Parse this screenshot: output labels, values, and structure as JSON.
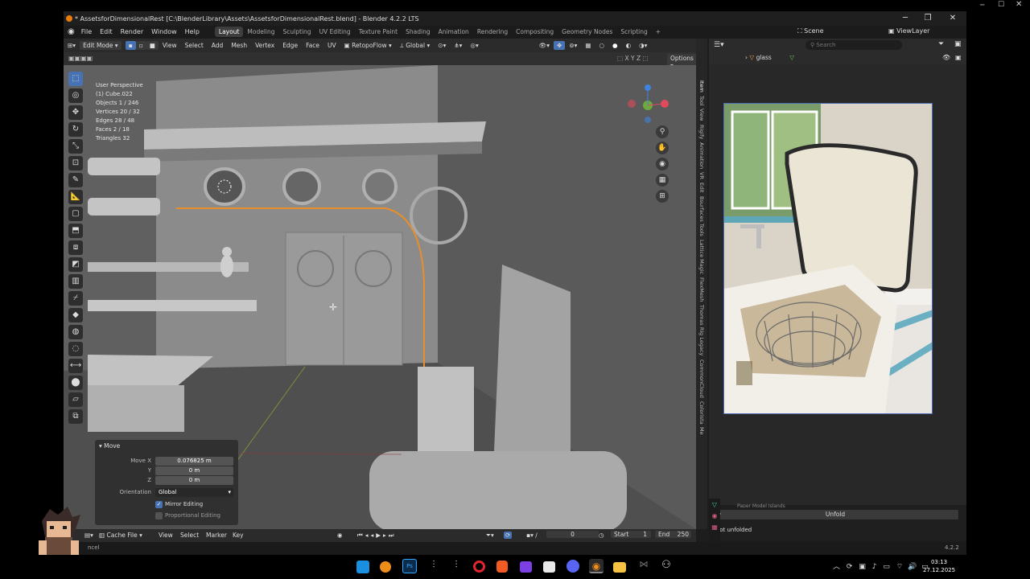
{
  "window": {
    "title": "* AssetsforDimensionalRest [C:\\BlenderLibrary\\Assets\\AssetsforDimensionalRest.blend] - Blender 4.2.2 LTS"
  },
  "menu": [
    "File",
    "Edit",
    "Render",
    "Window",
    "Help"
  ],
  "workspaces": [
    "Layout",
    "Modeling",
    "Sculpting",
    "UV Editing",
    "Texture Paint",
    "Shading",
    "Animation",
    "Rendering",
    "Compositing",
    "Geometry Nodes",
    "Scripting"
  ],
  "active_workspace": "Layout",
  "scene_label": "Scene",
  "viewlayer_label": "ViewLayer",
  "viewport_header": {
    "mode": "Edit Mode",
    "items": [
      "View",
      "Select",
      "Add",
      "Mesh",
      "Vertex",
      "Edge",
      "Face",
      "UV"
    ],
    "addon": "RetopoFlow",
    "orientation": "Global",
    "options": "Options"
  },
  "overlay_stats": {
    "view": "User Perspective",
    "object": "(1) Cube.022",
    "rows": [
      {
        "label": "Objects",
        "value": "1 / 246"
      },
      {
        "label": "Vertices",
        "value": "20 / 32"
      },
      {
        "label": "Edges",
        "value": "28 / 48"
      },
      {
        "label": "Faces",
        "value": "2 / 18"
      },
      {
        "label": "Triangles",
        "value": "32"
      }
    ]
  },
  "sidebar_tabs": [
    "Item",
    "Tool",
    "View",
    "Rigify",
    "Animation",
    "VR",
    "Edit",
    "Bsurfaces Tools",
    "Lattice Magic",
    "FlexMesh",
    "Thomas Rig Legacy",
    "CommonCloud",
    "Colorista",
    "Me"
  ],
  "outliner": {
    "search_placeholder": "Search",
    "item_label": "glass"
  },
  "move_panel": {
    "title": "Move",
    "move_x_label": "Move X",
    "move_x_value": "0.076825 m",
    "y_label": "Y",
    "y_value": "0 m",
    "z_label": "Z",
    "z_value": "0 m",
    "orientation_label": "Orientation",
    "orientation_value": "Global",
    "mirror_label": "Mirror Editing",
    "mirror_checked": true,
    "proportional_label": "Proportional Editing",
    "proportional_checked": false
  },
  "properties_panel": {
    "heading": "Paper Model Islands",
    "unfold_button": "Unfold",
    "status": "Not unfolded"
  },
  "timeline": {
    "editor": "Cache File",
    "items": [
      "View",
      "Select",
      "Marker",
      "Key"
    ],
    "current_frame": "0",
    "start_label": "Start",
    "start_value": "1",
    "end_label": "End",
    "end_value": "250"
  },
  "statusbar": {
    "left": "ncel",
    "version": "4.2.2"
  },
  "taskbar": {
    "time": "03:13",
    "date": "27.12.2025"
  },
  "colors": {
    "accent_blue": "#4772b3",
    "blender_orange": "#e87d0d",
    "viewport_bg": "#5f5f5f",
    "panel_bg": "#282828"
  }
}
